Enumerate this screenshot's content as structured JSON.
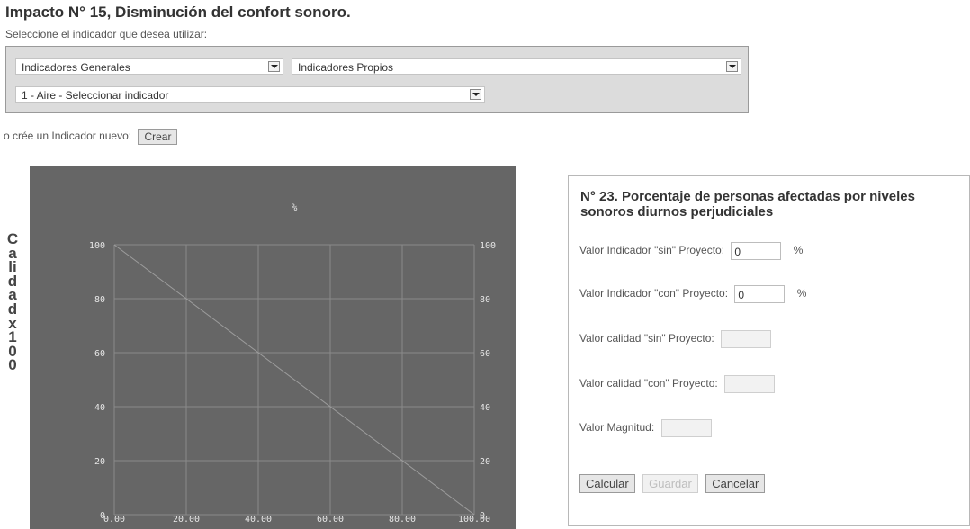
{
  "page": {
    "title": "Impacto N° 15, Disminución del confort sonoro.",
    "subtitle": "Seleccione el indicador que desea utilizar:"
  },
  "selectors": {
    "general": "Indicadores Generales",
    "propios": "Indicadores Propios",
    "aire": "1 - Aire - Seleccionar indicador"
  },
  "create": {
    "label": "o crée un Indicador nuevo:",
    "button": "Crear"
  },
  "chart_data": {
    "type": "line",
    "title": "%",
    "ylabel": "Calidadx100",
    "xlabel": "",
    "xlim": [
      0,
      100
    ],
    "ylim": [
      0,
      100
    ],
    "x_ticks": [
      "0.00",
      "20.00",
      "40.00",
      "60.00",
      "80.00",
      "100.00"
    ],
    "y_ticks": [
      "0",
      "20",
      "40",
      "60",
      "80",
      "100"
    ],
    "grid": true,
    "series": [
      {
        "x": [
          0,
          100
        ],
        "y": [
          100,
          0
        ]
      }
    ],
    "colors": {
      "background": "#666666",
      "grid": "#8a8a8a",
      "line": "#9c9c9c",
      "tick_text": "#e6e6e6"
    }
  },
  "indicator": {
    "title": "N° 23. Porcentaje de personas afectadas por niveles sonoros diurnos perjudiciales",
    "sin_label": "Valor Indicador \"sin\" Proyecto:",
    "sin_value": "0",
    "sin_unit": "%",
    "con_label": "Valor Indicador \"con\" Proyecto:",
    "con_value": "0",
    "con_unit": "%",
    "calidad_sin_label": "Valor calidad \"sin\" Proyecto:",
    "calidad_sin_value": "",
    "calidad_con_label": "Valor calidad \"con\" Proyecto:",
    "calidad_con_value": "",
    "magnitud_label": "Valor Magnitud:",
    "magnitud_value": ""
  },
  "actions": {
    "calcular": "Calcular",
    "guardar": "Guardar",
    "cancelar": "Cancelar"
  }
}
